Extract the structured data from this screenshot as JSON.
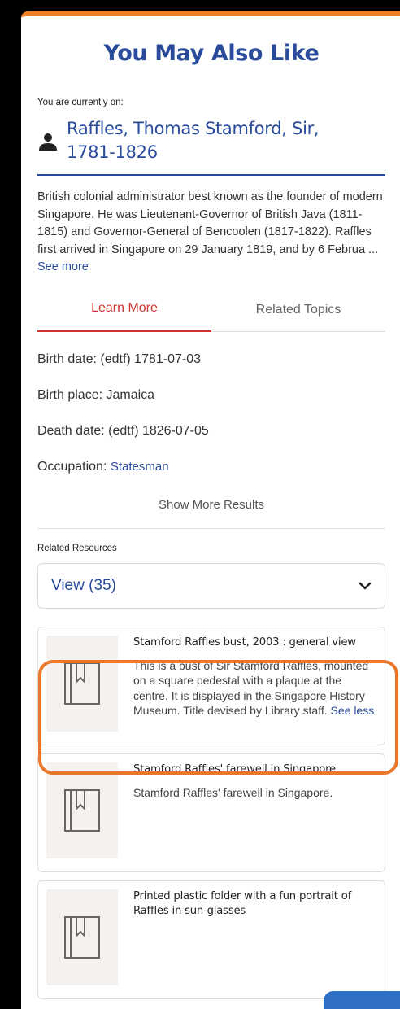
{
  "header": {
    "title": "You May Also Like"
  },
  "current": {
    "label": "You are currently on:",
    "name": "Raffles, Thomas Stamford, Sir, 1781-1826",
    "name_line1": "Raffles, Thomas Stamford, Sir,",
    "name_line2": "1781-1826",
    "description": "British colonial administrator best known as the founder of modern Singapore. He was Lieutenant-Governor of British Java (1811-1815) and Governor-General of Bencoolen (1817-1822). Raffles first arrived in Singapore on 29 January 1819, and by 6 Februa ... ",
    "see_more": "See more"
  },
  "tabs": [
    {
      "label": "Learn More",
      "active": true
    },
    {
      "label": "Related Topics",
      "active": false
    }
  ],
  "facts": [
    {
      "label": "Birth date: (edtf) 1781-07-03"
    },
    {
      "label": "Birth place: Jamaica"
    },
    {
      "label": "Death date: (edtf) 1826-07-05"
    },
    {
      "label": "Occupation: ",
      "link": "Statesman"
    }
  ],
  "show_more": "Show More Results",
  "related": {
    "label": "Related Resources",
    "dropdown_label": "View (35)",
    "items": [
      {
        "title": "Stamford Raffles bust, 2003 : general view",
        "description": "This is a bust of Sir Stamford Raffles, mounted on a square pedestal with a plaque at the centre. It is displayed in the Singapore History Museum. Title devised by Library staff. ",
        "see_less": "See less"
      },
      {
        "title": "Stamford Raffles' farewell in Singapore",
        "description": "Stamford Raffles' farewell in Singapore."
      },
      {
        "title": "Printed plastic folder with a fun portrait of Raffles in sun-glasses",
        "description": ""
      }
    ]
  },
  "colors": {
    "accent": "#2a4b9b",
    "active_tab": "#d0312d",
    "highlight": "#e9772b",
    "top_border": "#f07f22"
  }
}
